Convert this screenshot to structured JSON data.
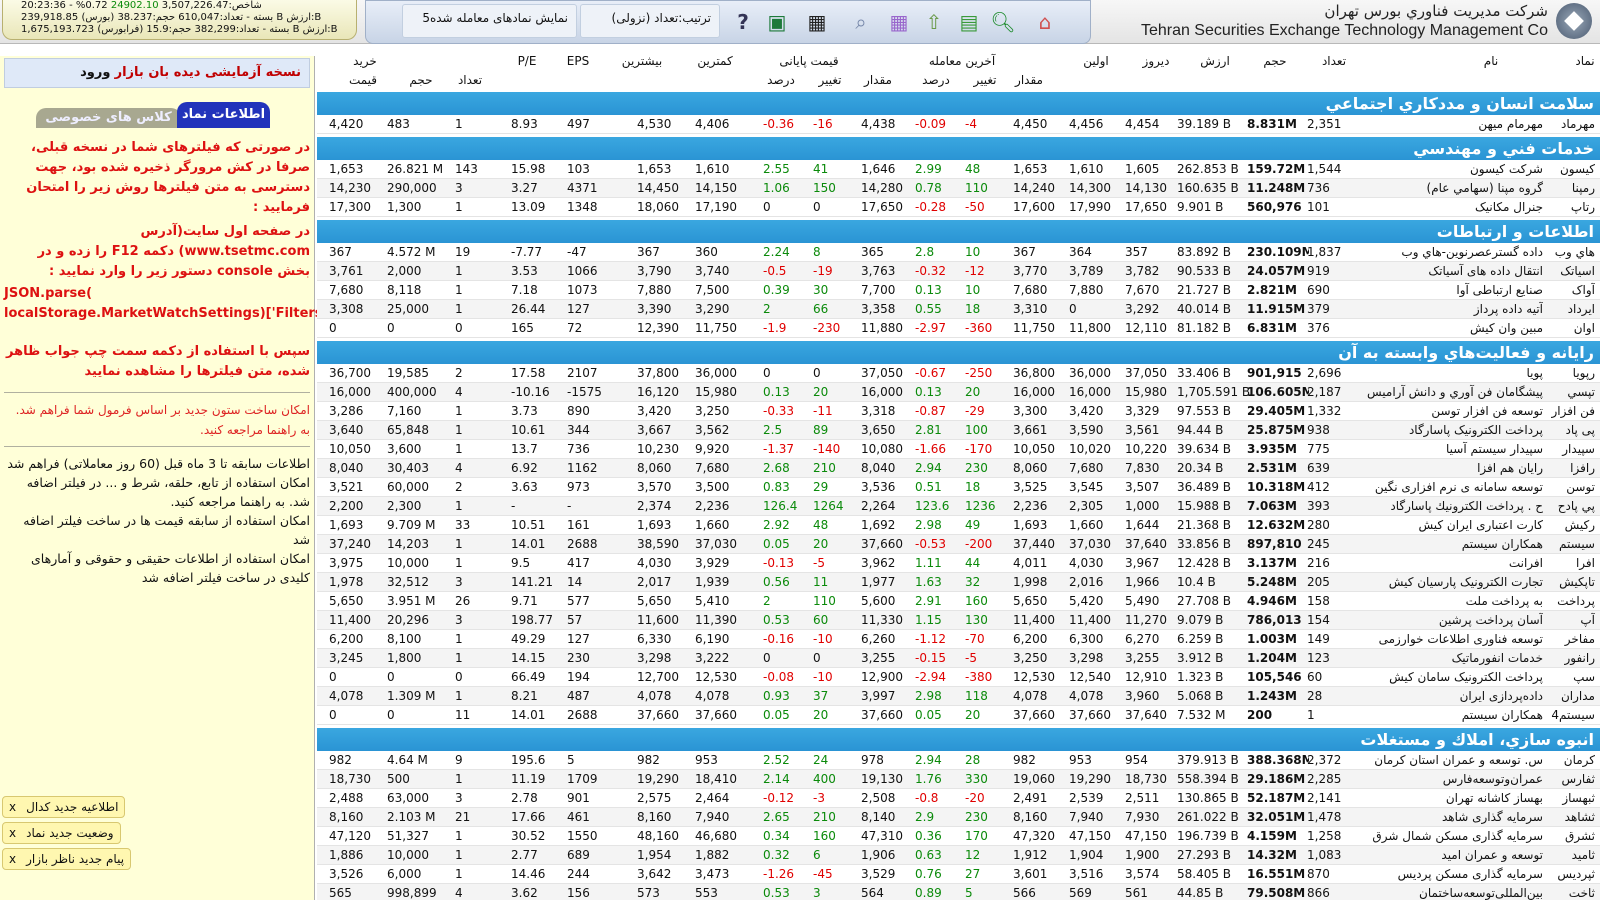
{
  "header": {
    "company_fa": "شركت مديريت فناوري بورس تهران",
    "company_en": "Tehran Securities Exchange Technology Management Co",
    "sort_label": "ترتیب:تعداد (نزولی)",
    "show_label": "5نمایش نمادهای معامله شده",
    "ticker": [
      {
        "pre": "20:23:36 - ",
        "change": "%0.72",
        "index": "24902.10",
        "post": " 3,507,226.47:شاخص"
      },
      {
        "pre": "239,918.85 ",
        "change": "",
        "index": "",
        "post": "(بورس) بسته - تعداد:610,047 حجم:38.237 B ارزش:B"
      },
      {
        "pre": "1,675,193.723 ",
        "change": "",
        "index": "",
        "post": "(فرابورس) بسته - تعداد:382,299 حجم:15.9 B ارزش:B"
      }
    ],
    "icons": [
      "home-icon",
      "search-icon",
      "grid-icon",
      "up-arrow-icon",
      "calendar-icon",
      "search-doc-icon",
      "apps-icon",
      "excel-icon",
      "help-icon"
    ]
  },
  "left": {
    "login": "ورود",
    "test_version": "نسخه آزمایشی دیده بان بازار",
    "tab_info": "اطلاعات نماد",
    "tab_classes": "کلاس های خصوصی",
    "help_p1": "در صورتی که فیلترهای شما در نسخه قبلی، صرفا در کش مرورگر ذخیره شده بود، جهت دسترسی به متن فیلترها روش زیر را امتحان فرمایید :",
    "help_p2": "در صفحه اول سایت(آدرس www.tsetmc.com) دکمه F12 را زده و در بخش console دستور زیر را وارد نمایید :",
    "code": "JSON.parse(\nlocalStorage.MarketWatchSettings)['Filters']",
    "help_p3": "سپس با استفاده از دکمه سمت چپ جواب ظاهر شده، متن فیلترها را مشاهده نمایید",
    "note1": "امکان ساخت ستون جدید بر اساس فرمول شما فراهم شد. به راهنما مراجعه کنید.",
    "notes": [
      "اطلاعات سابقه تا 3 ماه قبل (60 روز معاملاتی) فراهم شد",
      "امکان استفاده از تابع، حلقه، شرط و ... در فیلتر اضافه شد. به راهنما مراجعه کنید.",
      "امکان استفاده از سابقه قیمت ها در ساخت فیلتر اضافه شد",
      "امکان استفاده از اطلاعات حقیقی و حقوقی و آمارهای کلیدی در ساخت فیلتر اضافه شد"
    ],
    "notifications": [
      {
        "label": "اطلاعیه جدید کدال",
        "x": "x"
      },
      {
        "label": "وضعیت جدید نماد",
        "x": "x"
      },
      {
        "label": "پیام جدید ناظر بازار",
        "x": "x"
      }
    ]
  },
  "columns": {
    "top": {
      "symbol": "نماد",
      "name": "نام",
      "count": "تعداد",
      "volume": "حجم",
      "value": "ارزش",
      "yesterday": "دیروز",
      "first": "اولین",
      "last_trade": "آخرین معامله",
      "final_price": "قیمت پایانی",
      "min": "کمترین",
      "max": "بیشترین",
      "eps": "EPS",
      "pe": "P/E",
      "buy": "خرید"
    },
    "sub": {
      "amount1": "مقدار",
      "change1": "تغییر",
      "percent1": "درصد",
      "amount2": "مقدار",
      "change2": "تغییر",
      "percent2": "درصد",
      "buy_count": "تعداد",
      "buy_volume": "حجم",
      "buy_price": "قیمت"
    }
  },
  "sections": [
    {
      "title": "سلامت انسان و مددکاري اجتماعي",
      "rows": [
        [
          "مهرماد",
          "مهرمام میهن",
          "2,351",
          "8.831M",
          "39.189 B",
          "4,454",
          "4,456",
          "4,450",
          "-4",
          "-0.09",
          "4,438",
          "-16",
          "-0.36",
          "4,406",
          "4,530",
          "497",
          "8.93",
          "1",
          "483",
          "4,420"
        ]
      ]
    },
    {
      "title": "خدمات فني و مهندسي",
      "rows": [
        [
          "کیسون",
          "شرکت کیسون",
          "1,544",
          "159.72M",
          "262.853 B",
          "1,605",
          "1,610",
          "1,653",
          "48",
          "2.99",
          "1,646",
          "41",
          "2.55",
          "1,610",
          "1,653",
          "103",
          "15.98",
          "143",
          "26.821 M",
          "1,653"
        ],
        [
          "رمپنا",
          "گروه مپنا (سهامي عام)",
          "736",
          "11.248M",
          "160.635 B",
          "14,130",
          "14,300",
          "14,240",
          "110",
          "0.78",
          "14,280",
          "150",
          "1.06",
          "14,150",
          "14,450",
          "4371",
          "3.27",
          "3",
          "290,000",
          "14,230"
        ],
        [
          "رتاپ",
          "جنرال مکانیک",
          "101",
          "560,976",
          "9.901 B",
          "17,650",
          "17,990",
          "17,600",
          "-50",
          "-0.28",
          "17,650",
          "0",
          "0",
          "17,190",
          "18,060",
          "1348",
          "13.09",
          "1",
          "1,300",
          "17,300"
        ]
      ]
    },
    {
      "title": "اطلاعات و ارتباطات",
      "rows": [
        [
          "هاي وب",
          "داده گسترعصرنوين-هاي وب",
          "1,837",
          "230.109M",
          "83.892 B",
          "357",
          "364",
          "367",
          "10",
          "2.8",
          "365",
          "8",
          "2.24",
          "360",
          "367",
          "-47",
          "-7.77",
          "19",
          "4.572 M",
          "367"
        ],
        [
          "اسیاتک",
          "انتقال داده های آسیاتک",
          "919",
          "24.057M",
          "90.533 B",
          "3,782",
          "3,789",
          "3,770",
          "-12",
          "-0.32",
          "3,763",
          "-19",
          "-0.5",
          "3,740",
          "3,790",
          "1066",
          "3.53",
          "1",
          "2,000",
          "3,761"
        ],
        [
          "آواک",
          "صنایع ارتباطی آوا",
          "690",
          "2.821M",
          "21.727 B",
          "7,670",
          "7,880",
          "7,680",
          "10",
          "0.13",
          "7,700",
          "30",
          "0.39",
          "7,500",
          "7,880",
          "1073",
          "7.18",
          "1",
          "8,118",
          "7,680"
        ],
        [
          "ایرداد",
          "آتیه داده پرداز",
          "379",
          "11.915M",
          "40.014 B",
          "3,292",
          "0",
          "3,310",
          "18",
          "0.55",
          "3,358",
          "66",
          "2",
          "3,290",
          "3,390",
          "127",
          "26.44",
          "1",
          "25,000",
          "3,308"
        ],
        [
          "اوان",
          "مبین وان کیش",
          "376",
          "6.831M",
          "81.182 B",
          "12,110",
          "11,800",
          "11,750",
          "-360",
          "-2.97",
          "11,880",
          "-230",
          "-1.9",
          "11,750",
          "12,390",
          "72",
          "165",
          "0",
          "0",
          "0"
        ]
      ]
    },
    {
      "title": "رايانه و فعاليت‌هاي وابسته به آن",
      "rows": [
        [
          "رپویا",
          "پویا",
          "2,696",
          "901,915",
          "33.406 B",
          "37,050",
          "36,000",
          "36,800",
          "-250",
          "-0.67",
          "37,050",
          "0",
          "0",
          "36,000",
          "37,800",
          "2107",
          "17.58",
          "2",
          "19,585",
          "36,700"
        ],
        [
          "تپسي",
          "پيشگامان فن آوري و دانش آرامیس",
          "2,187",
          "106.605M",
          "1,705.591 B",
          "15,980",
          "16,000",
          "16,000",
          "20",
          "0.13",
          "16,000",
          "20",
          "0.13",
          "15,980",
          "16,120",
          "-1575",
          "-10.16",
          "4",
          "400,000",
          "16,000"
        ],
        [
          "فن افزار",
          "توسعه فن افزار توسن",
          "1,332",
          "29.405M",
          "97.553 B",
          "3,329",
          "3,420",
          "3,300",
          "-29",
          "-0.87",
          "3,318",
          "-11",
          "-0.33",
          "3,250",
          "3,420",
          "890",
          "3.73",
          "1",
          "7,160",
          "3,286"
        ],
        [
          "پی پاد",
          "پرداخت الکترونیک پاسارگاد",
          "938",
          "25.875M",
          "94.44 B",
          "3,561",
          "3,590",
          "3,661",
          "100",
          "2.81",
          "3,650",
          "89",
          "2.5",
          "3,562",
          "3,667",
          "344",
          "10.61",
          "1",
          "65,848",
          "3,640"
        ],
        [
          "سپیدار",
          "سپیدار سیستم آسیا",
          "775",
          "3.935M",
          "39.634 B",
          "10,220",
          "10,020",
          "10,050",
          "-170",
          "-1.66",
          "10,080",
          "-140",
          "-1.37",
          "9,920",
          "10,230",
          "736",
          "13.7",
          "1",
          "3,600",
          "10,050"
        ],
        [
          "رافزا",
          "رایان هم افزا",
          "639",
          "2.531M",
          "20.34 B",
          "7,830",
          "7,680",
          "8,060",
          "230",
          "2.94",
          "8,040",
          "210",
          "2.68",
          "7,680",
          "8,060",
          "1162",
          "6.92",
          "4",
          "30,403",
          "8,040"
        ],
        [
          "توسن",
          "توسعه سامانه ی نرم افزاری نگین",
          "412",
          "10.318M",
          "36.489 B",
          "3,507",
          "3,545",
          "3,525",
          "18",
          "0.51",
          "3,536",
          "29",
          "0.83",
          "3,500",
          "3,570",
          "973",
          "3.63",
          "2",
          "60,000",
          "3,521"
        ],
        [
          "پي پادح",
          "ح . پرداخت الكترونيك پاسارگاد",
          "393",
          "7.063M",
          "15.988 B",
          "1,000",
          "2,305",
          "2,236",
          "1236",
          "123.6",
          "2,264",
          "1264",
          "126.4",
          "2,236",
          "2,374",
          "-",
          "-",
          "1",
          "2,300",
          "2,200"
        ],
        [
          "رکیش",
          "کارت اعتباری ایران کیش",
          "280",
          "12.632M",
          "21.368 B",
          "1,644",
          "1,660",
          "1,693",
          "49",
          "2.98",
          "1,692",
          "48",
          "2.92",
          "1,660",
          "1,693",
          "161",
          "10.51",
          "33",
          "9.709 M",
          "1,693"
        ],
        [
          "سیستم",
          "همکاران سیستم",
          "245",
          "897,810",
          "33.856 B",
          "37,640",
          "37,030",
          "37,440",
          "-200",
          "-0.53",
          "37,660",
          "20",
          "0.05",
          "37,030",
          "38,590",
          "2688",
          "14.01",
          "1",
          "14,203",
          "37,240"
        ],
        [
          "افرا",
          "افرانت",
          "216",
          "3.137M",
          "12.428 B",
          "3,967",
          "4,030",
          "4,011",
          "44",
          "1.11",
          "3,962",
          "-5",
          "-0.13",
          "3,929",
          "4,030",
          "417",
          "9.5",
          "1",
          "10,000",
          "3,975"
        ],
        [
          "تاپکیش",
          "تجارت الکترونیک پارسیان کیش",
          "205",
          "5.248M",
          "10.4 B",
          "1,966",
          "2,016",
          "1,998",
          "32",
          "1.63",
          "1,977",
          "11",
          "0.56",
          "1,939",
          "2,017",
          "14",
          "141.21",
          "3",
          "32,512",
          "1,978"
        ],
        [
          "پرداخت",
          "به پرداخت ملت",
          "158",
          "4.946M",
          "27.708 B",
          "5,490",
          "5,420",
          "5,650",
          "160",
          "2.91",
          "5,600",
          "110",
          "2",
          "5,410",
          "5,650",
          "577",
          "9.71",
          "26",
          "3.951 M",
          "5,650"
        ],
        [
          "آپ",
          "آسان پرداخت پرشین",
          "154",
          "786,013",
          "9.079 B",
          "11,270",
          "11,400",
          "11,400",
          "130",
          "1.15",
          "11,330",
          "60",
          "0.53",
          "11,390",
          "11,600",
          "57",
          "198.77",
          "3",
          "20,296",
          "11,400"
        ],
        [
          "مفاخر",
          "توسعه فناوری اطلاعات خوارزمی",
          "149",
          "1.003M",
          "6.259 B",
          "6,270",
          "6,300",
          "6,200",
          "-70",
          "-1.12",
          "6,260",
          "-10",
          "-0.16",
          "6,190",
          "6,330",
          "127",
          "49.29",
          "1",
          "8,100",
          "6,200"
        ],
        [
          "رانفور",
          "خدمات انفورماتیک",
          "123",
          "1.204M",
          "3.912 B",
          "3,255",
          "3,298",
          "3,250",
          "-5",
          "-0.15",
          "3,255",
          "0",
          "0",
          "3,222",
          "3,298",
          "230",
          "14.15",
          "1",
          "1,800",
          "3,245"
        ],
        [
          "سپ",
          "پرداخت الکترونیک سامان کیش",
          "60",
          "105,546",
          "1.323 B",
          "12,910",
          "12,540",
          "12,530",
          "-380",
          "-2.94",
          "12,900",
          "-10",
          "-0.08",
          "12,530",
          "12,700",
          "194",
          "66.49",
          "0",
          "0",
          "0"
        ],
        [
          "مداران",
          "داده‌پردازی ایران",
          "28",
          "1.243M",
          "5.068 B",
          "3,960",
          "4,078",
          "4,078",
          "118",
          "2.98",
          "3,997",
          "37",
          "0.93",
          "4,078",
          "4,078",
          "487",
          "8.21",
          "1",
          "1.309 M",
          "4,078"
        ],
        [
          "سیستم4",
          "همکاران سیستم",
          "1",
          "200",
          "7.532 M",
          "37,640",
          "37,660",
          "37,660",
          "20",
          "0.05",
          "37,660",
          "20",
          "0.05",
          "37,660",
          "37,660",
          "2688",
          "14.01",
          "11",
          "0",
          "0"
        ]
      ]
    },
    {
      "title": "انبوه سازي، املاك و مستغلات",
      "rows": [
        [
          "کرمان",
          "س. توسعه و عمران استان کرمان",
          "2,372",
          "388.368M",
          "379.913 B",
          "954",
          "953",
          "982",
          "28",
          "2.94",
          "978",
          "24",
          "2.52",
          "953",
          "982",
          "5",
          "195.6",
          "9",
          "4.64 M",
          "982"
        ],
        [
          "ثفارس",
          "عمران‌وتوسعه‌فارس",
          "2,285",
          "29.186M",
          "558.394 B",
          "18,730",
          "19,290",
          "19,060",
          "330",
          "1.76",
          "19,130",
          "400",
          "2.14",
          "18,410",
          "19,290",
          "1709",
          "11.19",
          "1",
          "500",
          "18,730"
        ],
        [
          "ثبهساز",
          "بهساز کاشانه تهران",
          "2,141",
          "52.187M",
          "130.865 B",
          "2,511",
          "2,539",
          "2,491",
          "-20",
          "-0.8",
          "2,508",
          "-3",
          "-0.12",
          "2,464",
          "2,575",
          "901",
          "2.78",
          "3",
          "63,000",
          "2,488"
        ],
        [
          "ثشاهد",
          "سرمایه گذاری شاهد",
          "1,478",
          "32.051M",
          "261.022 B",
          "7,930",
          "7,940",
          "8,160",
          "230",
          "2.9",
          "8,140",
          "210",
          "2.65",
          "7,940",
          "8,160",
          "461",
          "17.66",
          "21",
          "2.103 M",
          "8,160"
        ],
        [
          "ثشرق",
          "سرمایه گذاری مسکن شمال شرق",
          "1,258",
          "4.159M",
          "196.739 B",
          "47,150",
          "47,150",
          "47,320",
          "170",
          "0.36",
          "47,310",
          "160",
          "0.34",
          "46,680",
          "48,160",
          "1550",
          "30.52",
          "1",
          "51,327",
          "47,120"
        ],
        [
          "ثامید",
          "توسعه و عمران امید",
          "1,083",
          "14.32M",
          "27.293 B",
          "1,900",
          "1,904",
          "1,912",
          "12",
          "0.63",
          "1,906",
          "6",
          "0.32",
          "1,882",
          "1,954",
          "689",
          "2.77",
          "1",
          "10,000",
          "1,886"
        ],
        [
          "ثپردیس",
          "سرمایه گذاری مسکن پردیس",
          "870",
          "16.551M",
          "58.405 B",
          "3,574",
          "3,516",
          "3,601",
          "27",
          "0.76",
          "3,529",
          "-45",
          "-1.26",
          "3,473",
          "3,642",
          "244",
          "14.46",
          "1",
          "6,000",
          "3,526"
        ],
        [
          "ثاخت",
          "بین‌المللی‌توسعه‌ساختمان",
          "866",
          "79.508M",
          "44.85 B",
          "561",
          "569",
          "566",
          "5",
          "0.89",
          "564",
          "3",
          "0.53",
          "553",
          "573",
          "156",
          "3.62",
          "4",
          "998,899",
          "565"
        ]
      ]
    }
  ]
}
